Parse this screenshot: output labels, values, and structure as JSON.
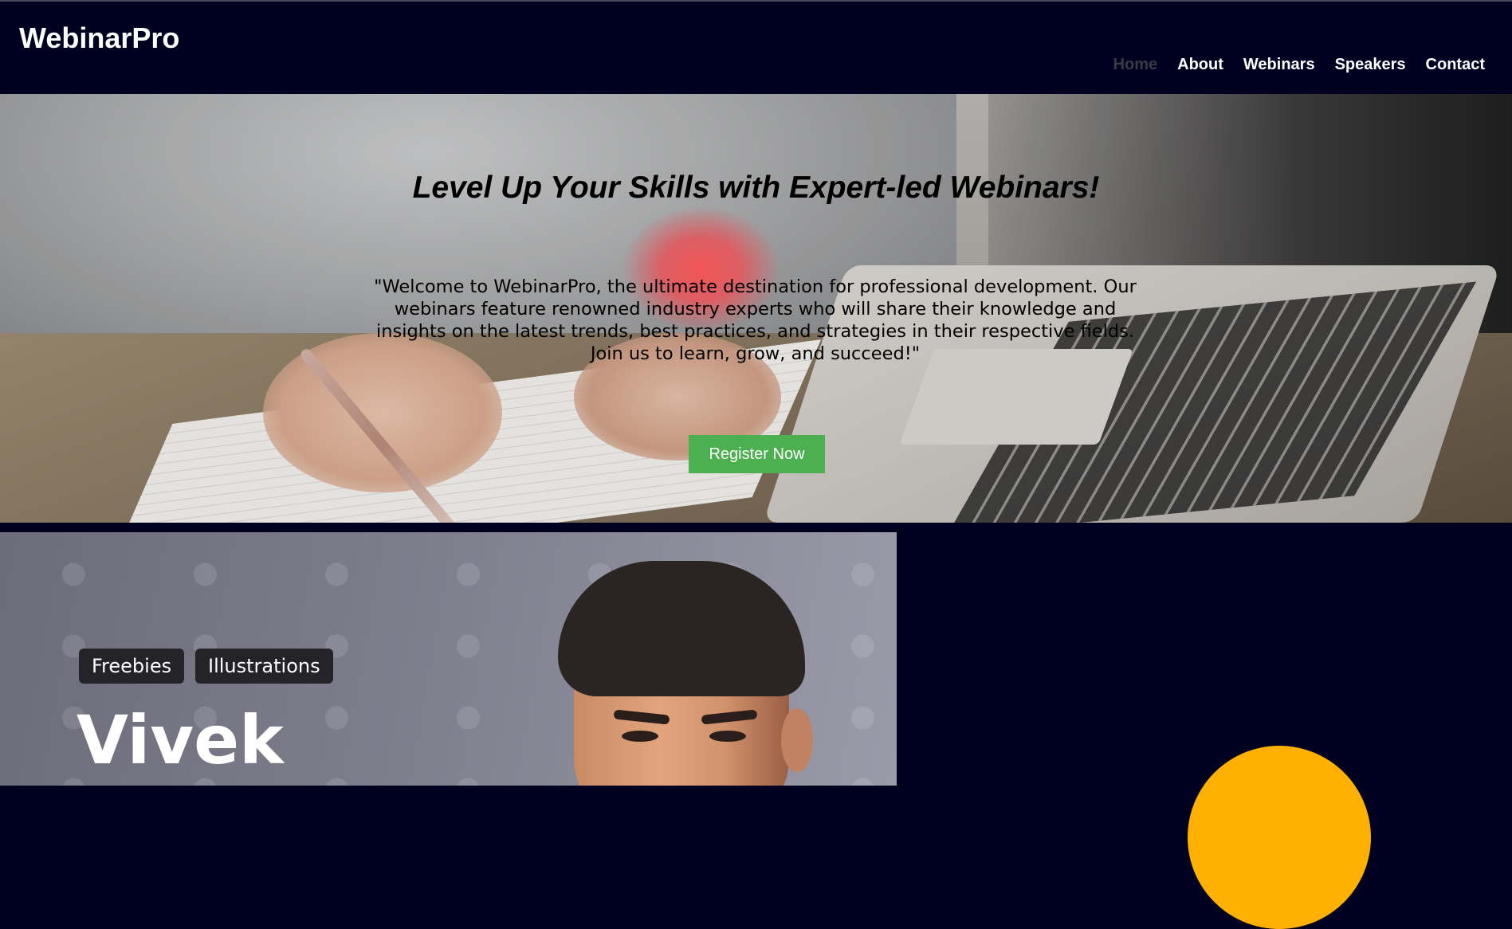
{
  "header": {
    "logo": "WebinarPro",
    "nav": [
      {
        "label": "Home",
        "active": true
      },
      {
        "label": "About",
        "active": false
      },
      {
        "label": "Webinars",
        "active": false
      },
      {
        "label": "Speakers",
        "active": false
      },
      {
        "label": "Contact",
        "active": false
      }
    ]
  },
  "hero": {
    "title": "Level Up Your Skills with Expert-led Webinars!",
    "description": "\"Welcome to WebinarPro, the ultimate destination for professional development. Our webinars feature renowned industry experts who will share their knowledge and insights on the latest trends, best practices, and strategies in their respective fields. Join us to learn, grow, and succeed!\"",
    "cta_label": "Register Now"
  },
  "speaker_banner": {
    "tags": [
      "Freebies",
      "Illustrations"
    ],
    "name": "Vivek"
  },
  "colors": {
    "background": "#000020",
    "cta": "#4caf50",
    "accent_circle": "#ffb000",
    "nav_active": "#3a3a45"
  }
}
